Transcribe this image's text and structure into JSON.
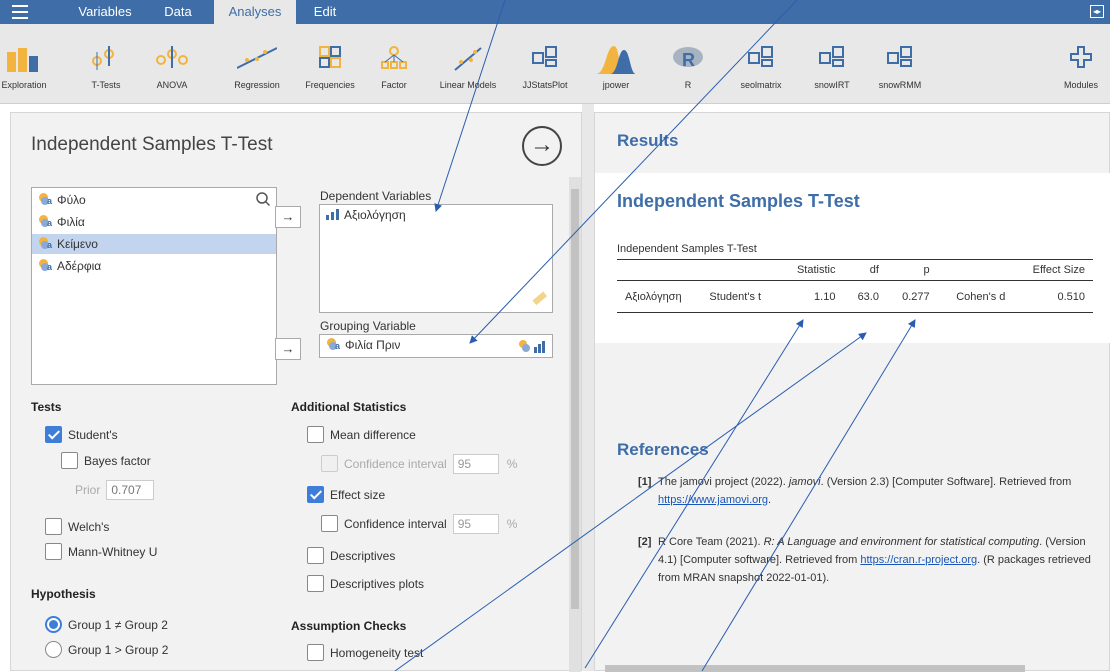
{
  "menu": {
    "tabs": [
      "Variables",
      "Data",
      "Analyses",
      "Edit"
    ],
    "active_tab": "Analyses"
  },
  "ribbon": {
    "items": [
      "Exploration",
      "T-Tests",
      "ANOVA",
      "Regression",
      "Frequencies",
      "Factor",
      "Linear Models",
      "JJStatsPlot",
      "jpower",
      "R",
      "seolmatrix",
      "snowIRT",
      "snowRMM",
      "Modules"
    ]
  },
  "analysis": {
    "title": "Independent Samples T-Test",
    "variables": [
      "Φύλο",
      "Φιλία",
      "Κείμενο",
      "Αδέρφια"
    ],
    "selected_variable": "Κείμενο",
    "dependent_label": "Dependent Variables",
    "dependent_items": [
      "Αξιολόγηση"
    ],
    "grouping_label": "Grouping Variable",
    "grouping_item": "Φιλία Πριν",
    "tests": {
      "heading": "Tests",
      "students": "Student's",
      "bayes": "Bayes factor",
      "prior_label": "Prior",
      "prior_value": "0.707",
      "welch": "Welch's",
      "mann": "Mann-Whitney U"
    },
    "hypothesis": {
      "heading": "Hypothesis",
      "opt1": "Group 1 ≠ Group 2",
      "opt2": "Group 1 > Group 2"
    },
    "additional": {
      "heading": "Additional Statistics",
      "mean_diff": "Mean difference",
      "ci_label": "Confidence interval",
      "ci_value": "95",
      "percent": "%",
      "effect_size": "Effect size",
      "ci2_label": "Confidence interval",
      "ci2_value": "95",
      "descriptives": "Descriptives",
      "desc_plots": "Descriptives plots"
    },
    "assumptions": {
      "heading": "Assumption Checks",
      "homogeneity": "Homogeneity test"
    }
  },
  "results": {
    "heading": "Results",
    "table_heading": "Independent Samples T-Test",
    "caption": "Independent Samples T-Test",
    "columns": [
      "",
      "",
      "Statistic",
      "df",
      "p",
      "",
      "Effect Size"
    ],
    "row": [
      "Αξιολόγηση",
      "Student's t",
      "1.10",
      "63.0",
      "0.277",
      "Cohen's d",
      "0.510"
    ]
  },
  "references": {
    "heading": "References",
    "r1_num": "[1]",
    "r1_pre": "The jamovi project (2022). ",
    "r1_italic": "jamovi",
    "r1_mid": ". (Version 2.3) [Computer Software]. Retrieved from ",
    "r1_link": "https://www.jamovi.org",
    "r1_end": ".",
    "r2_num": "[2]",
    "r2_pre": "R Core Team (2021). ",
    "r2_italic": "R: A Language and environment for statistical computing",
    "r2_mid": ". (Version 4.1) [Computer software]. Retrieved from ",
    "r2_link": "https://cran.r-project.org",
    "r2_end": ". (R packages retrieved from MRAN snapshot 2022-01-01)."
  }
}
